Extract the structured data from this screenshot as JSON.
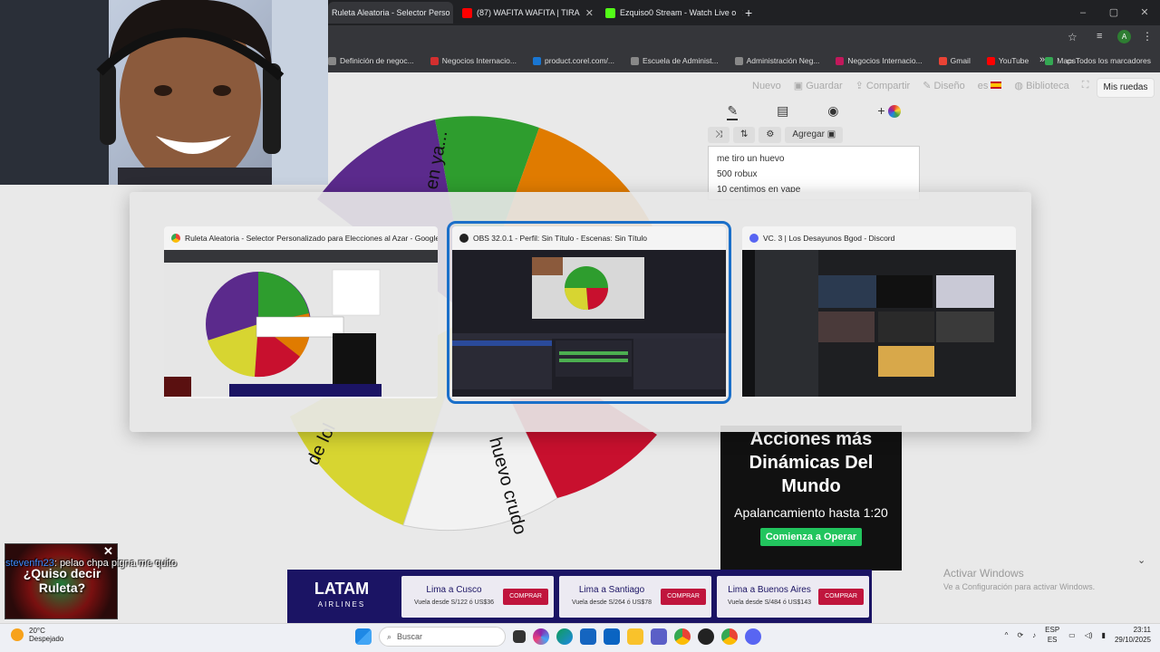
{
  "browser": {
    "tabs": [
      {
        "label": "Ruleta Aleatoria - Selector Perso",
        "fav": "#e53935",
        "active": true
      },
      {
        "label": "(87) WAFITA WAFITA | TIRA",
        "fav": "#ff0000",
        "active": false
      },
      {
        "label": "Ezquiso0 Stream - Watch Live o",
        "fav": "#53fc18",
        "active": false
      }
    ],
    "new_tab": "+",
    "window_controls": [
      "–",
      "▢",
      "✕"
    ],
    "profile_initial": "A",
    "bookmarks": [
      {
        "label": "Definición de negoc...",
        "color": "#888"
      },
      {
        "label": "Negocios Internacio...",
        "color": "#d32f2f"
      },
      {
        "label": "product.corel.com/...",
        "color": "#1976d2"
      },
      {
        "label": "Escuela de Administ...",
        "color": "#888"
      },
      {
        "label": "Administración Neg...",
        "color": "#888"
      },
      {
        "label": "Negocios Internacio...",
        "color": "#c2185b"
      },
      {
        "label": "Gmail",
        "color": "#ea4335"
      },
      {
        "label": "YouTube",
        "color": "#ff0000"
      },
      {
        "label": "Maps",
        "color": "#34a853"
      }
    ],
    "more_bookmarks": "»",
    "all_bookmarks": "Todos los marcadores"
  },
  "page": {
    "toolbar": [
      "Nuevo",
      "Guardar",
      "Compartir",
      "Diseño",
      "es",
      "Biblioteca"
    ],
    "mis_ruedas": "Mis ruedas",
    "tools_row2_add": "Agregar",
    "entries": [
      "me tiro un huevo",
      "500 robux",
      "10 centimos en yape"
    ],
    "wheel_labels": [
      "en ya...",
      "de lol",
      "huevo crudo"
    ]
  },
  "ad_right": {
    "headline": "Acciones más Dinámicas Del Mundo",
    "sub": "Apalancamiento hasta 1:20",
    "cta": "Comienza a Operar"
  },
  "banner": {
    "brand": "LATAM",
    "brand_sub": "AIRLINES",
    "offers": [
      {
        "title": "Lima a Cusco",
        "sub": "Vuela desde S/122 ó US$36",
        "button": "COMPRAR"
      },
      {
        "title": "Lima a Santiago",
        "sub": "Vuela desde S/264 ó US$78",
        "button": "COMPRAR"
      },
      {
        "title": "Lima a Buenos Aires",
        "sub": "Vuela desde S/484 ó US$143",
        "button": "COMPRAR"
      }
    ]
  },
  "activate": {
    "title": "Activar Windows",
    "sub": "Ve a Configuración para activar Windows."
  },
  "chat": {
    "thumb_text": "¿Quiso decir Ruleta?",
    "user": "stevenfn23",
    "message": ": pelao chpa pigna me quito"
  },
  "switcher": {
    "windows": [
      {
        "title": "Ruleta Aleatoria - Selector Personalizado para Elecciones al Azar - Google...",
        "icon_color": "#e53935",
        "selected": false
      },
      {
        "title": "OBS 32.0.1 - Perfil: Sin Título - Escenas: Sin Título",
        "icon_color": "#222222",
        "selected": true
      },
      {
        "title": "VC. 3 | Los Desayunos Bgod - Discord",
        "icon_color": "#5865f2",
        "selected": false
      }
    ]
  },
  "taskbar": {
    "temp": "20°C",
    "weather": "Despejado",
    "search": "Buscar",
    "lang": "ESP",
    "lang2": "ES",
    "time": "23:11",
    "date": "29/10/2025"
  }
}
